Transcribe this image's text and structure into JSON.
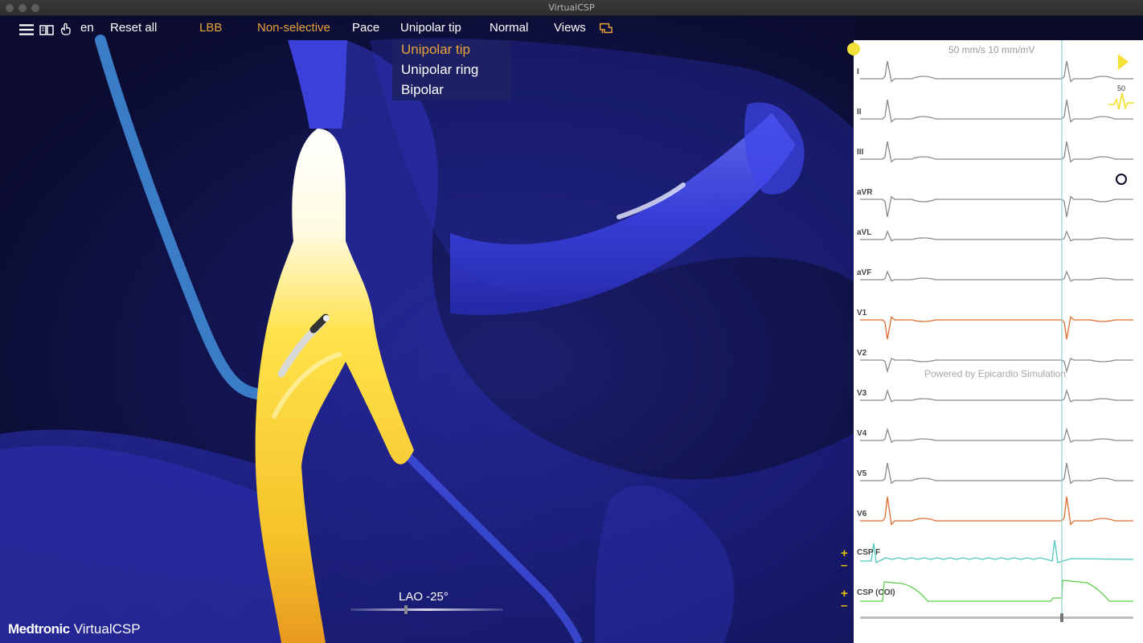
{
  "window": {
    "title": "VirtualCSP"
  },
  "toolbar": {
    "language": "en",
    "reset_label": "Reset all",
    "target_label": "LBB",
    "capture_label": "Non-selective",
    "pace_label": "Pace",
    "polarity_label": "Unipolar tip",
    "mode_label": "Normal",
    "views_label": "Views"
  },
  "polarity_menu": {
    "options": [
      "Unipolar tip",
      "Unipolar ring",
      "Bipolar"
    ],
    "selected": "Unipolar tip"
  },
  "view": {
    "angle_label": "LAO -25°",
    "slider_value": 0.37
  },
  "brand": {
    "company": "Medtronic",
    "product": "VirtualCSP"
  },
  "ecg": {
    "speed_label": "50 mm/s  10 mm/mV",
    "watermark": "Powered by Epicardio Simulation",
    "heart_rate": "50",
    "leads": [
      "I",
      "II",
      "III",
      "aVR",
      "aVL",
      "aVF",
      "V1",
      "V2",
      "V3",
      "V4",
      "V5",
      "V6"
    ],
    "channels": [
      "CSP F",
      "CSP (COI)"
    ],
    "colors": {
      "limb": "#8a8a8a",
      "orange": "#e06c2c",
      "cyan": "#4fc9c0",
      "green": "#5ecf4a",
      "cursor": "#8fd3cc",
      "accent": "#e8a23a",
      "yellow": "#f4e23a"
    },
    "icons": [
      "status-dot-icon",
      "play-icon",
      "heart-rate-icon",
      "caliper-icon",
      "camera-icon"
    ],
    "playhead_fraction": 0.72
  }
}
